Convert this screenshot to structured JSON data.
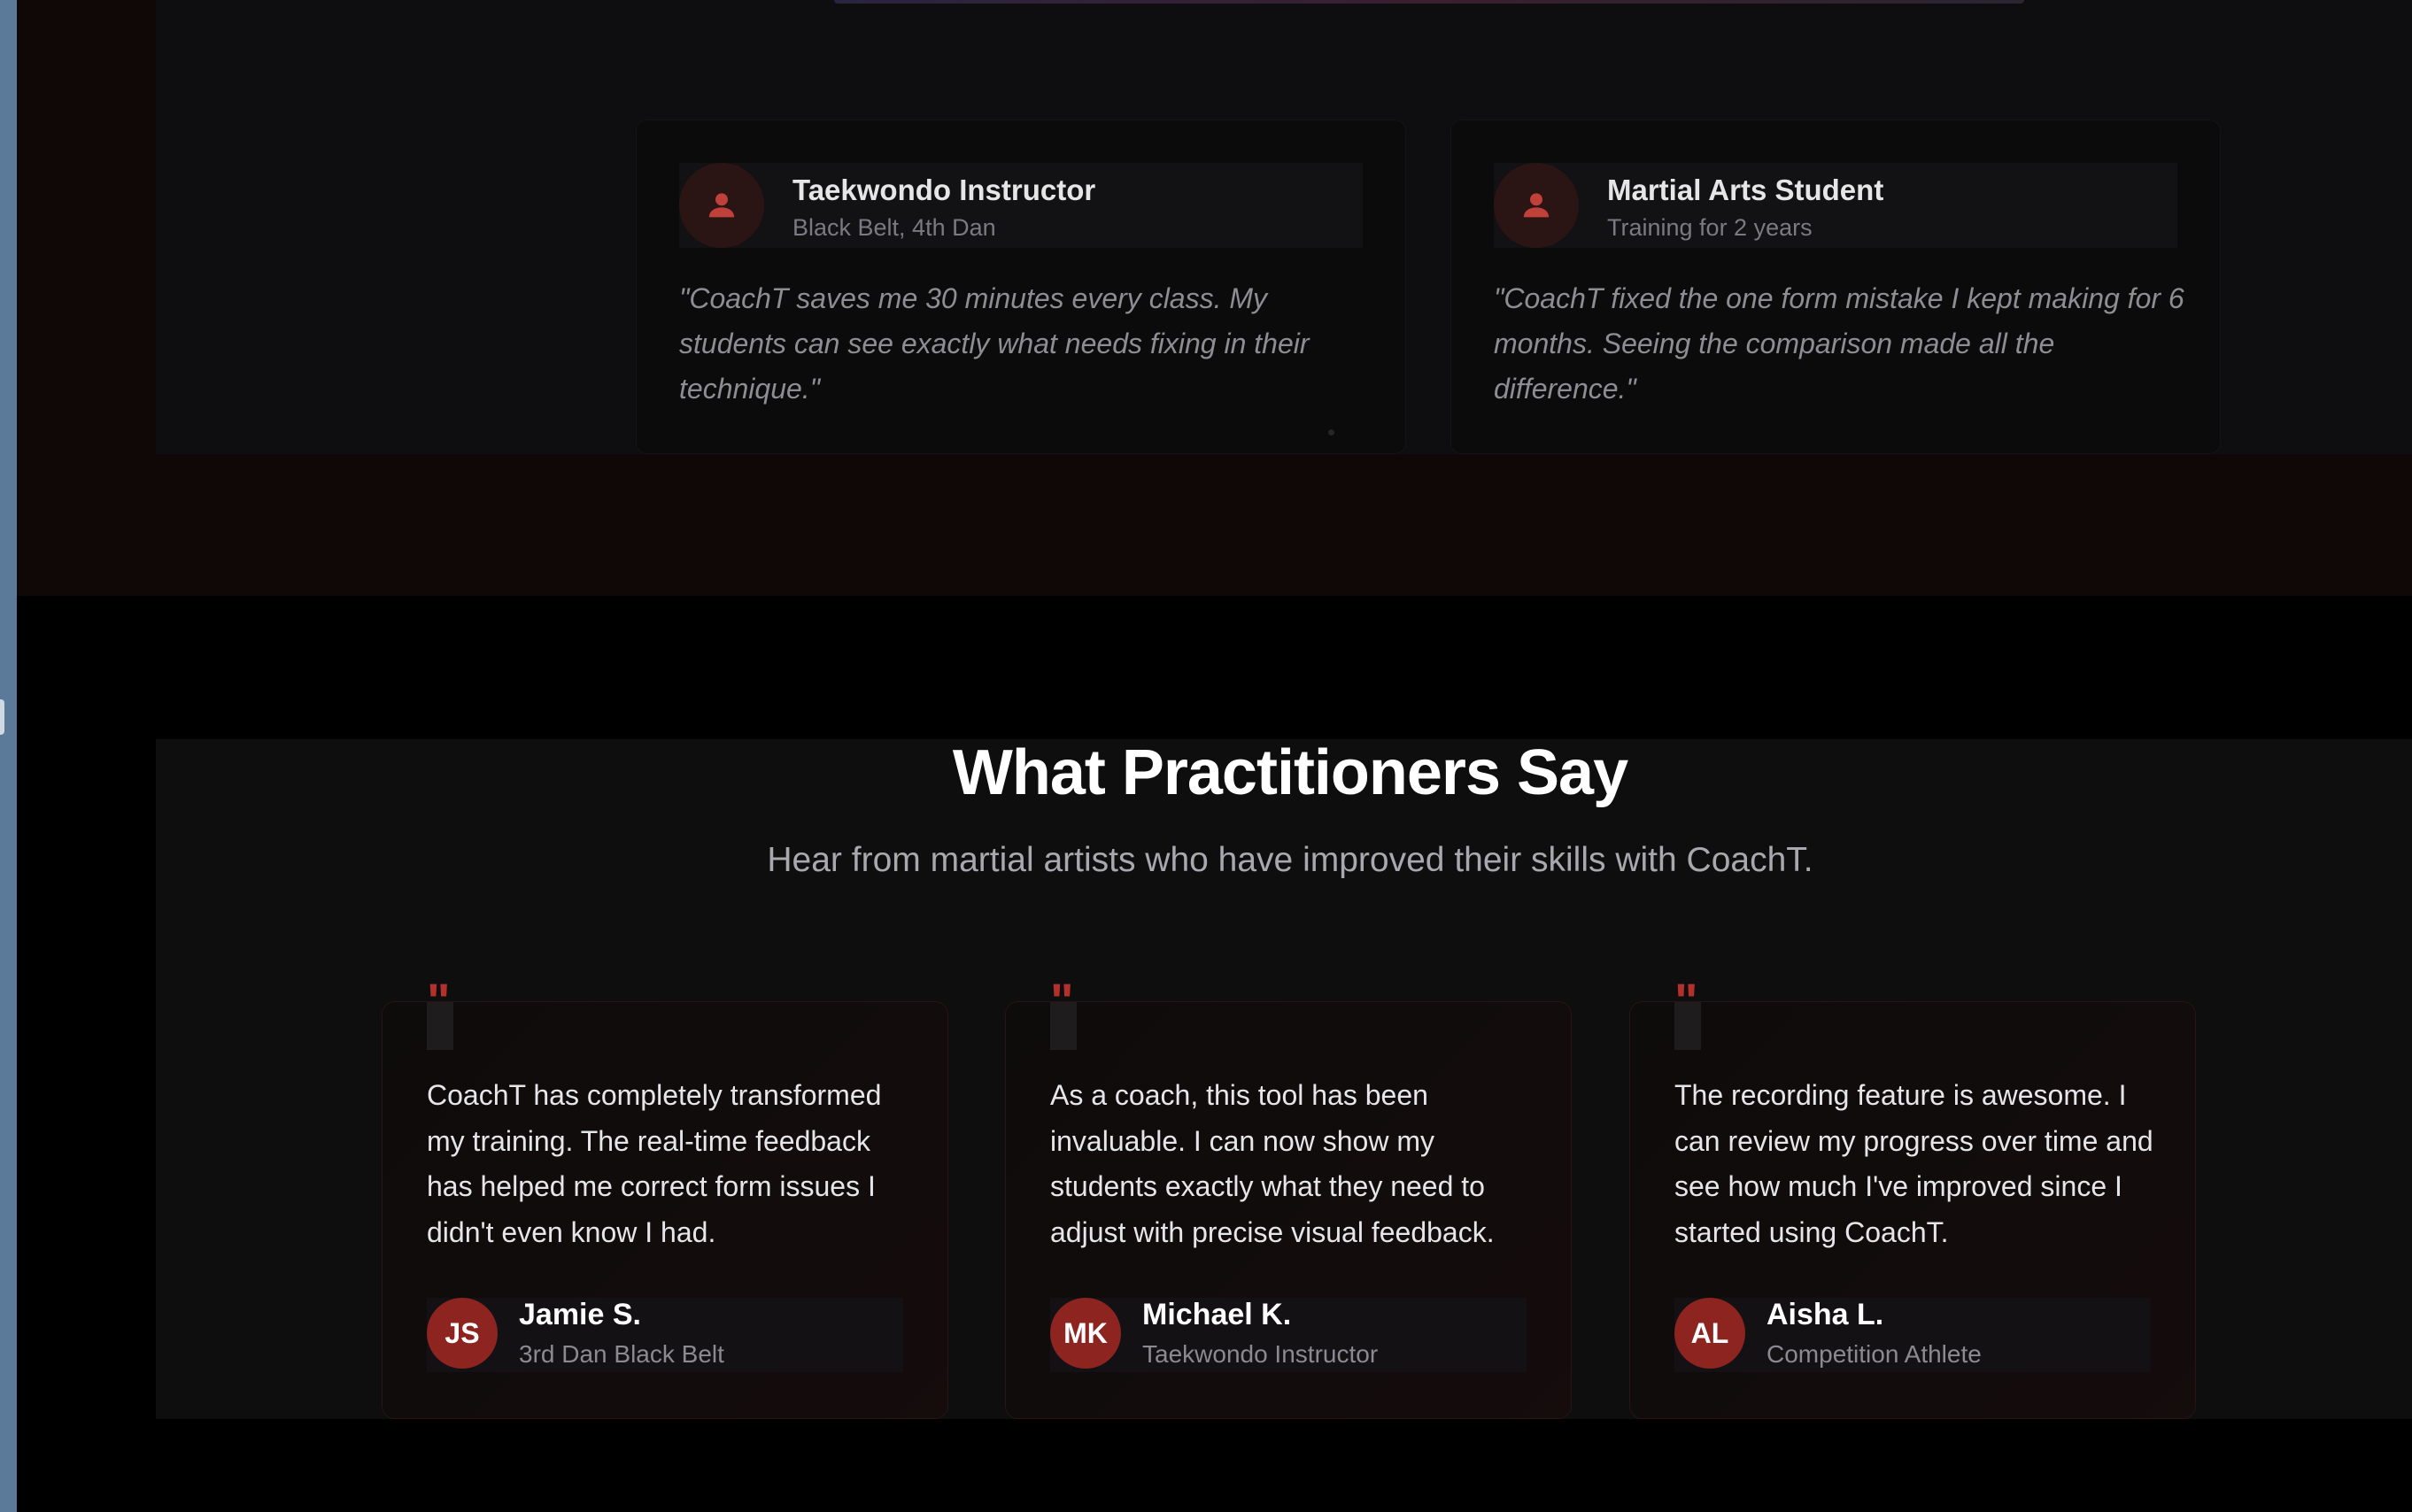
{
  "colors": {
    "accent": "#b3302c",
    "avatar_bg": "#8d2420",
    "background": "#000000"
  },
  "upper_cards": [
    {
      "role": "Taekwondo Instructor",
      "sub": "Black Belt, 4th Dan",
      "icon": "user-icon",
      "quote": "\"CoachT saves me 30 minutes every class. My students can see exactly what needs fixing in their technique.\""
    },
    {
      "role": "Martial Arts Student",
      "sub": "Training for 2 years",
      "icon": "user-icon",
      "quote": "\"CoachT fixed the one form mistake I kept making for 6 months. Seeing the comparison made all the difference.\""
    }
  ],
  "testimonials_section": {
    "title": "What Practitioners Say",
    "subtitle": "Hear from martial artists who have improved their skills with CoachT.",
    "quote_mark": "\"",
    "cards": [
      {
        "text": "CoachT has completely transformed my training. The real-time feedback has helped me correct form issues I didn't even know I had.",
        "initials": "JS",
        "name": "Jamie S.",
        "title": "3rd Dan Black Belt"
      },
      {
        "text": "As a coach, this tool has been invaluable. I can now show my students exactly what they need to adjust with precise visual feedback.",
        "initials": "MK",
        "name": "Michael K.",
        "title": "Taekwondo Instructor"
      },
      {
        "text": "The recording feature is awesome. I can review my progress over time and see how much I've improved since I started using CoachT.",
        "initials": "AL",
        "name": "Aisha L.",
        "title": "Competition Athlete"
      }
    ]
  }
}
